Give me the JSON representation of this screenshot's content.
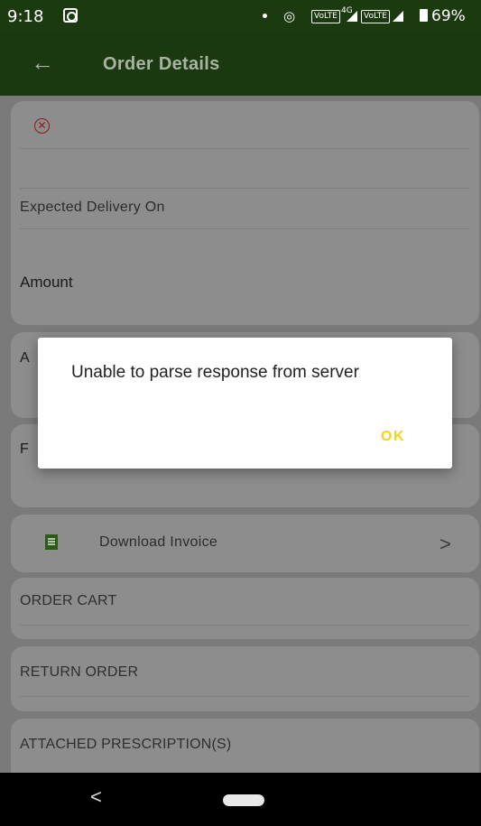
{
  "status_bar": {
    "time": "9:18",
    "network_tag_1": "VoLTE",
    "network_gen": "4G",
    "network_tag_2": "VoLTE",
    "battery": "69%"
  },
  "app_bar": {
    "title": "Order Details",
    "back_icon": "arrow-left-icon",
    "color": "#1b3910"
  },
  "order": {
    "expected_delivery_label": "Expected Delivery On",
    "amount_label": "Amount",
    "partial_label_1": "A",
    "partial_label_2": "F"
  },
  "actions": {
    "download_invoice": "Download Invoice",
    "order_cart": "ORDER CART",
    "return_order": "RETURN ORDER",
    "attached_prescriptions": "ATTACHED PRESCRIPTION(S)"
  },
  "dialog": {
    "message": "Unable to parse response from server",
    "ok_label": "OK",
    "ok_color": "#f6d21c"
  },
  "nav_bar": {
    "back_glyph": "<"
  }
}
